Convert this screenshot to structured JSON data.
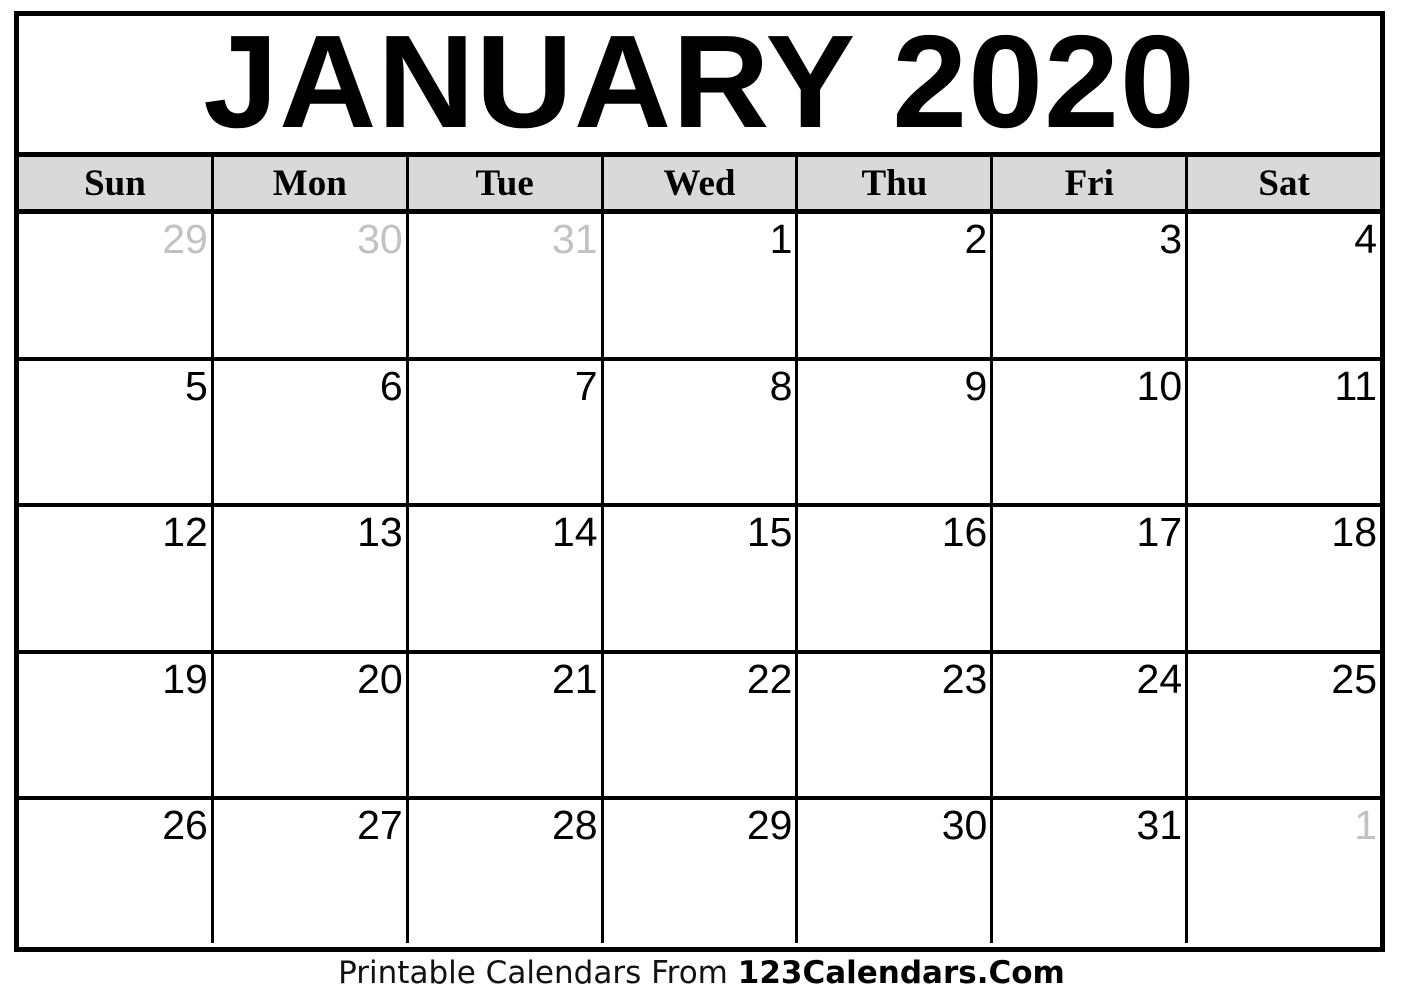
{
  "calendar": {
    "title": "JANUARY 2020",
    "month": "January",
    "year": "2020",
    "colors": {
      "header_background": "#d9d9d9",
      "border": "#000000",
      "current_month_text": "#000000",
      "adjacent_month_text": "#c2c2c2",
      "page_background": "#ffffff"
    },
    "weekdays": [
      {
        "label": "Sun"
      },
      {
        "label": "Mon"
      },
      {
        "label": "Tue"
      },
      {
        "label": "Wed"
      },
      {
        "label": "Thu"
      },
      {
        "label": "Fri"
      },
      {
        "label": "Sat"
      }
    ],
    "weeks": [
      [
        {
          "number": "29",
          "adjacent": true
        },
        {
          "number": "30",
          "adjacent": true
        },
        {
          "number": "31",
          "adjacent": true
        },
        {
          "number": "1",
          "adjacent": false
        },
        {
          "number": "2",
          "adjacent": false
        },
        {
          "number": "3",
          "adjacent": false
        },
        {
          "number": "4",
          "adjacent": false
        }
      ],
      [
        {
          "number": "5",
          "adjacent": false
        },
        {
          "number": "6",
          "adjacent": false
        },
        {
          "number": "7",
          "adjacent": false
        },
        {
          "number": "8",
          "adjacent": false
        },
        {
          "number": "9",
          "adjacent": false
        },
        {
          "number": "10",
          "adjacent": false
        },
        {
          "number": "11",
          "adjacent": false
        }
      ],
      [
        {
          "number": "12",
          "adjacent": false
        },
        {
          "number": "13",
          "adjacent": false
        },
        {
          "number": "14",
          "adjacent": false
        },
        {
          "number": "15",
          "adjacent": false
        },
        {
          "number": "16",
          "adjacent": false
        },
        {
          "number": "17",
          "adjacent": false
        },
        {
          "number": "18",
          "adjacent": false
        }
      ],
      [
        {
          "number": "19",
          "adjacent": false
        },
        {
          "number": "20",
          "adjacent": false
        },
        {
          "number": "21",
          "adjacent": false
        },
        {
          "number": "22",
          "adjacent": false
        },
        {
          "number": "23",
          "adjacent": false
        },
        {
          "number": "24",
          "adjacent": false
        },
        {
          "number": "25",
          "adjacent": false
        }
      ],
      [
        {
          "number": "26",
          "adjacent": false
        },
        {
          "number": "27",
          "adjacent": false
        },
        {
          "number": "28",
          "adjacent": false
        },
        {
          "number": "29",
          "adjacent": false
        },
        {
          "number": "30",
          "adjacent": false
        },
        {
          "number": "31",
          "adjacent": false
        },
        {
          "number": "1",
          "adjacent": true
        }
      ]
    ]
  },
  "footer": {
    "prefix": "Printable Calendars From ",
    "brand": "123Calendars.Com"
  }
}
